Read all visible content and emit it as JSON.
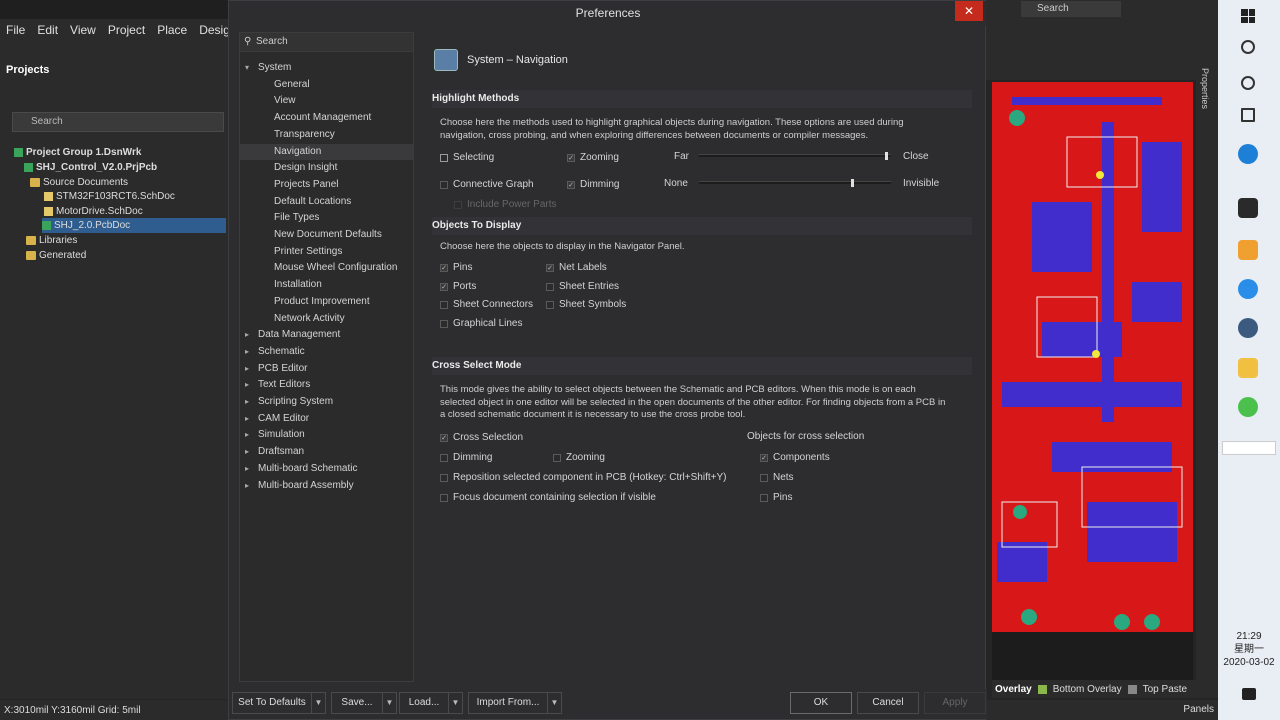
{
  "app": {
    "menu": [
      "File",
      "Edit",
      "View",
      "Project",
      "Place",
      "Design"
    ],
    "projects_title": "Projects",
    "search_placeholder": "Search",
    "tree": [
      {
        "label": "Project Group 1.DsnWrk"
      },
      {
        "label": "SHJ_Control_V2.0.PrjPcb"
      },
      {
        "label": "Source Documents"
      },
      {
        "label": "STM32F103RCT6.SchDoc"
      },
      {
        "label": "MotorDrive.SchDoc"
      },
      {
        "label": "SHJ_2.0.PcbDoc"
      },
      {
        "label": "Libraries"
      },
      {
        "label": "Generated"
      }
    ],
    "status": "X:3010mil Y:3160mil    Grid: 5mil",
    "top_search": "Search",
    "layers": {
      "l0": "Overlay",
      "l1": "Bottom Overlay",
      "l2": "Top Paste"
    },
    "panels_label": "Panels",
    "properties_label": "Properties",
    "colors": {
      "pcb_red": "#d81818",
      "pcb_blue": "#3030e0",
      "close_red": "#c42b1c"
    }
  },
  "taskbar": {
    "time": "21:29",
    "day": "星期一",
    "date": "2020-03-02"
  },
  "dialog": {
    "title": "Preferences",
    "search_placeholder": "Search",
    "nav": {
      "system": "System",
      "system_children": [
        "General",
        "View",
        "Account Management",
        "Transparency",
        "Navigation",
        "Design Insight",
        "Projects Panel",
        "Default Locations",
        "File Types",
        "New Document Defaults",
        "Printer Settings",
        "Mouse Wheel Configuration",
        "Installation",
        "Product Improvement",
        "Network Activity"
      ],
      "groups": [
        "Data Management",
        "Schematic",
        "PCB Editor",
        "Text Editors",
        "Scripting System",
        "CAM Editor",
        "Simulation",
        "Draftsman",
        "Multi-board Schematic",
        "Multi-board Assembly"
      ]
    },
    "page_title": "System – Navigation",
    "highlight": {
      "header": "Highlight Methods",
      "desc": "Choose here the methods used to highlight graphical objects during navigation. These options are used during navigation, cross probing, and when exploring differences between documents or compiler messages.",
      "selecting": "Selecting",
      "zooming": "Zooming",
      "far": "Far",
      "close": "Close",
      "zoom_level": 0.98,
      "connective_graph": "Connective Graph",
      "dimming": "Dimming",
      "none": "None",
      "invisible": "Invisible",
      "dim_level": 0.8,
      "include_power": "Include Power Parts"
    },
    "objects": {
      "header": "Objects To Display",
      "desc": "Choose here the objects to display in the Navigator Panel.",
      "pins": "Pins",
      "net_labels": "Net Labels",
      "ports": "Ports",
      "sheet_entries": "Sheet Entries",
      "sheet_connectors": "Sheet Connectors",
      "sheet_symbols": "Sheet Symbols",
      "graphical_lines": "Graphical Lines"
    },
    "cross": {
      "header": "Cross Select Mode",
      "desc": "This mode gives the ability to select objects between the Schematic and PCB editors.  When this mode is on each selected object in one editor will be selected in the open documents of the other editor.  For finding objects from a PCB in a closed schematic document it is necessary to use the cross probe tool.",
      "cross_selection": "Cross Selection",
      "objects_for": "Objects for cross selection",
      "dimming": "Dimming",
      "zooming": "Zooming",
      "components": "Components",
      "reposition": "Reposition selected component in PCB (Hotkey: Ctrl+Shift+Y)",
      "nets": "Nets",
      "focus": "Focus document containing selection if visible",
      "pins": "Pins"
    },
    "buttons": {
      "set_defaults": "Set To Defaults",
      "save": "Save...",
      "load": "Load...",
      "import": "Import From...",
      "ok": "OK",
      "cancel": "Cancel",
      "apply": "Apply"
    }
  }
}
